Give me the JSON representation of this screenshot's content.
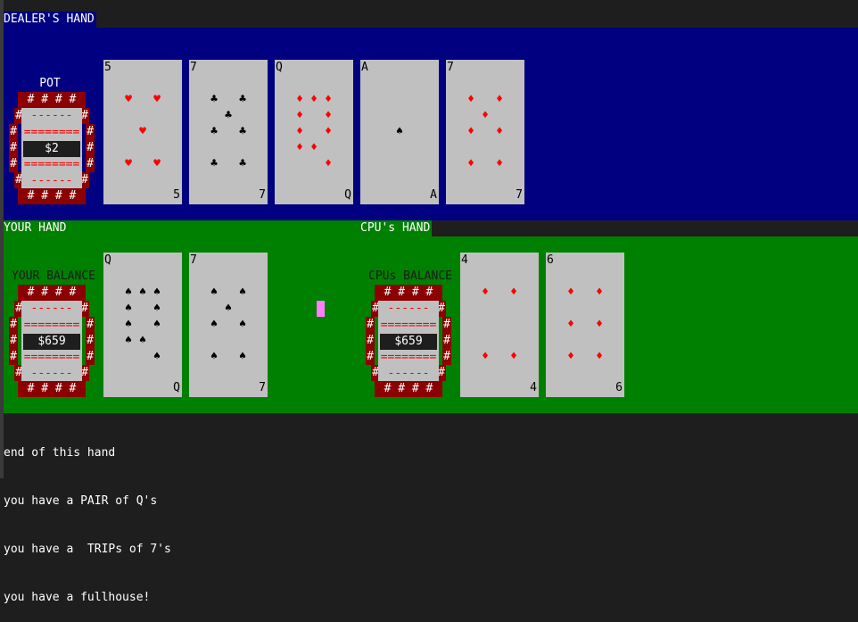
{
  "labels": {
    "dealer_hand": "DEALER'S HAND",
    "your_hand": "YOUR HAND",
    "cpu_hand": "CPU's HAND",
    "pot": "POT",
    "your_balance": "YOUR BALANCE",
    "cpu_balance": "CPUs BALANCE"
  },
  "chips": {
    "pot_amount": "$2",
    "your_amount": "$659",
    "cpu_amount": "$659",
    "hash_row": "# # # #",
    "dash_short": "------",
    "dash_long": "========",
    "hash": "#"
  },
  "dealer_cards": [
    {
      "rank": "5",
      "suit": "♥",
      "color": "red"
    },
    {
      "rank": "7",
      "suit": "♣",
      "color": "black"
    },
    {
      "rank": "Q",
      "suit": "♦",
      "color": "red"
    },
    {
      "rank": "A",
      "suit": "♠",
      "color": "black"
    },
    {
      "rank": "7",
      "suit": "♦",
      "color": "red"
    }
  ],
  "your_cards": [
    {
      "rank": "Q",
      "suit": "♠",
      "color": "black"
    },
    {
      "rank": "7",
      "suit": "♠",
      "color": "black"
    }
  ],
  "cpu_cards": [
    {
      "rank": "4",
      "suit": "♦",
      "color": "red"
    },
    {
      "rank": "6",
      "suit": "♦",
      "color": "red"
    }
  ],
  "log": [
    "end of this hand",
    "you have a PAIR of Q's",
    "you have a  TRIPs of 7's",
    "you have a fullhouse!"
  ],
  "colors": {
    "dealer_bg": "#000080",
    "player_bg": "#008000",
    "chip_ring": "#8b0000",
    "card_face": "#c0c0c0",
    "cursor": "#ff80ff"
  }
}
